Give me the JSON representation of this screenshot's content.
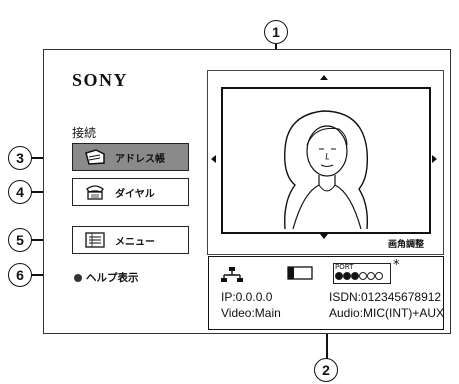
{
  "brand": "SONY",
  "section_title": "接続",
  "menu": [
    {
      "label": "アドレス帳",
      "icon": "address-book-icon",
      "selected": true
    },
    {
      "label": "ダイヤル",
      "icon": "dial-phone-icon",
      "selected": false
    },
    {
      "label": "メニュー",
      "icon": "menu-list-icon",
      "selected": false
    }
  ],
  "help_label": "ヘルプ表示",
  "video": {
    "zoom_label": "画角調整"
  },
  "status": {
    "ip": "IP:0.0.0.0",
    "isdn": "ISDN:012345678912",
    "video": "Video:Main",
    "audio": "Audio:MIC(INT)+AUX",
    "port_label": "PORT",
    "asterisk": "*"
  },
  "callouts": [
    "1",
    "2",
    "3",
    "4",
    "5",
    "6"
  ]
}
